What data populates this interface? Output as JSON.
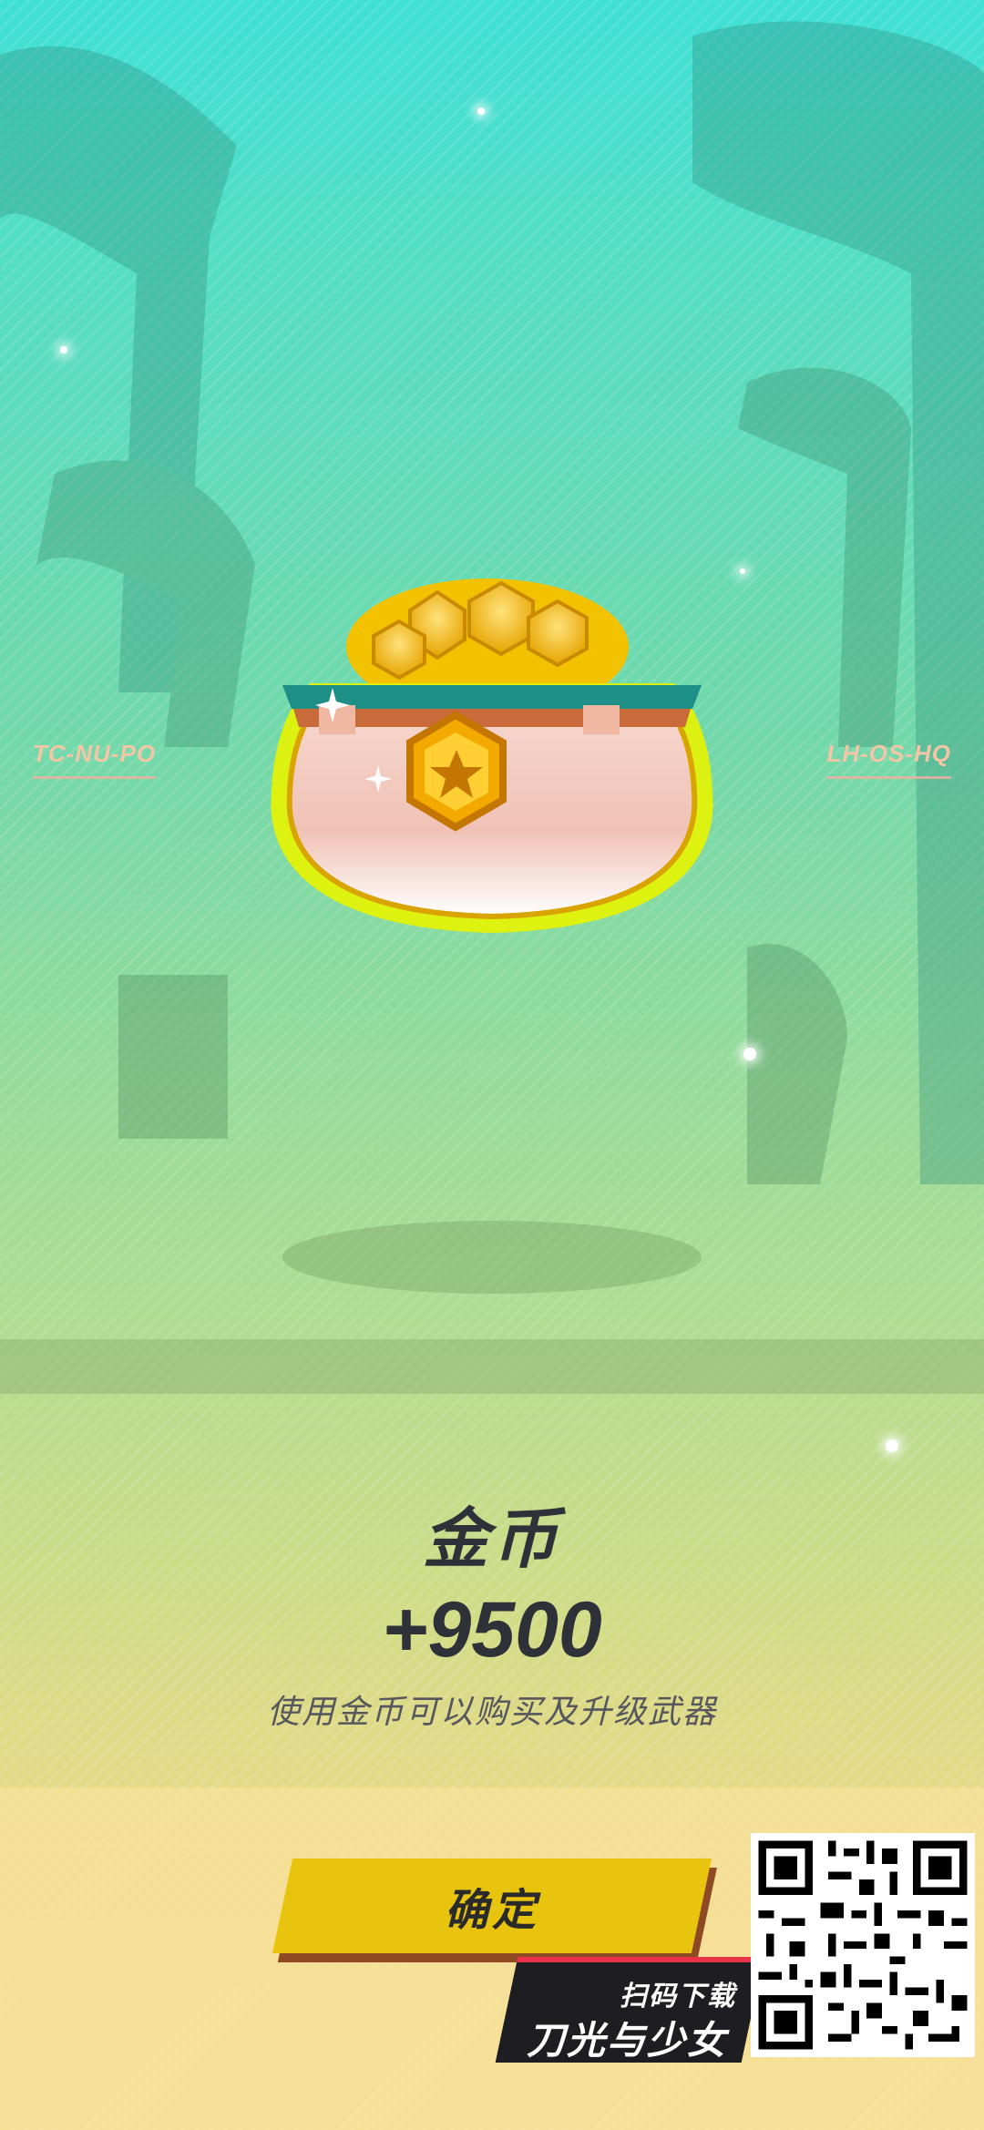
{
  "reward": {
    "left_code": "TC-NU-PO",
    "right_code": "LH-OS-HQ",
    "title": "金币",
    "amount": "+9500",
    "description": "使用金币可以购买及升级武器",
    "icon": "gold-coin-pot-icon"
  },
  "actions": {
    "confirm_label": "确定"
  },
  "promo": {
    "scan_label": "扫码下载",
    "game_name": "刀光与少女",
    "icon": "qr-code-icon"
  },
  "colors": {
    "bg_top": "#3fe0d6",
    "bg_bottom": "#f2d98f",
    "button": "#e8c40e",
    "button_shadow": "#8e4a22",
    "promo_bg": "#1e1e22",
    "promo_accent": "#e8334a"
  }
}
